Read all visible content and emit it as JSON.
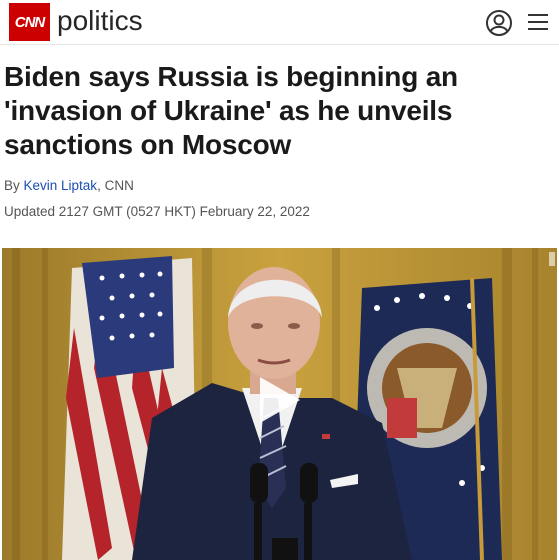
{
  "header": {
    "logo_text": "CNN",
    "section": "politics",
    "user_icon": "user-circle-icon",
    "menu_icon": "hamburger-menu-icon"
  },
  "article": {
    "headline": "Biden says Russia is beginning an 'invasion of Ukraine' as he unveils sanctions on Moscow",
    "byline_prefix": "By ",
    "author": "Kevin Liptak",
    "byline_suffix": ", CNN",
    "updated": "Updated 2127 GMT (0527 HKT) February 22, 2022"
  },
  "video": {
    "play_icon": "play-icon"
  },
  "colors": {
    "brand_red": "#cc0000",
    "link_blue": "#1d4fb3"
  }
}
